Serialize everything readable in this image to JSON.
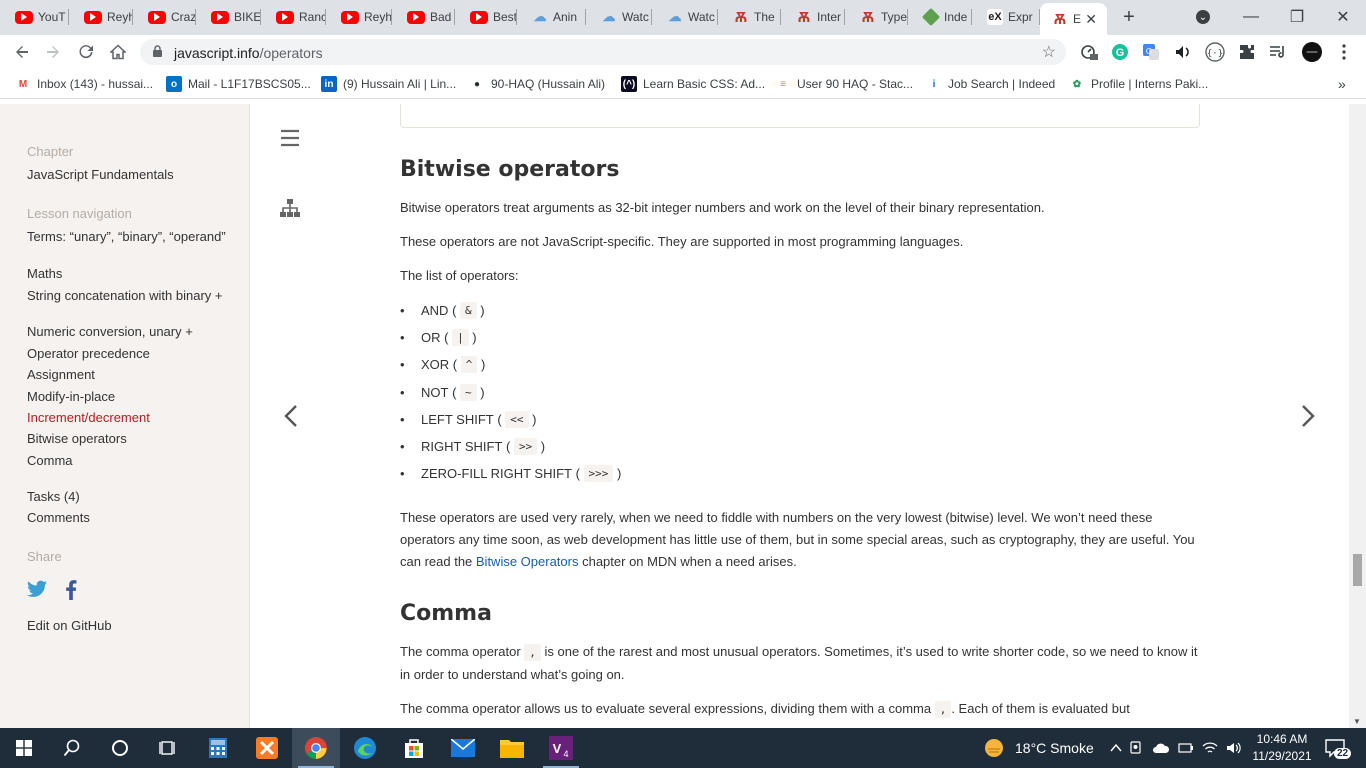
{
  "browser": {
    "tabs": [
      {
        "title": "YouT",
        "icon": "youtube-icon"
      },
      {
        "title": "Reyh",
        "icon": "youtube-icon"
      },
      {
        "title": "Craz",
        "icon": "youtube-icon"
      },
      {
        "title": "BIKE",
        "icon": "youtube-icon"
      },
      {
        "title": "Ranc",
        "icon": "youtube-icon"
      },
      {
        "title": "Reyh",
        "icon": "youtube-icon"
      },
      {
        "title": "Bad",
        "icon": "youtube-icon"
      },
      {
        "title": "Best",
        "icon": "youtube-icon"
      },
      {
        "title": "Anin",
        "icon": "cloud-icon"
      },
      {
        "title": "Watc",
        "icon": "cloud-icon"
      },
      {
        "title": "Watc",
        "icon": "cloud-icon"
      },
      {
        "title": "The",
        "icon": "javascript-info-icon"
      },
      {
        "title": "Inter",
        "icon": "javascript-info-icon"
      },
      {
        "title": "Type",
        "icon": "javascript-info-icon"
      },
      {
        "title": "Inde",
        "icon": "nodejs-icon"
      },
      {
        "title": "Expr",
        "icon": "ex-icon"
      },
      {
        "title": "E",
        "icon": "javascript-info-icon",
        "active": true
      }
    ],
    "new_tab_label": "+",
    "url_host": "javascript.info",
    "url_path": "/operators",
    "bookmarks": [
      {
        "label": "Inbox (143) - hussai...",
        "icon": "gmail-icon"
      },
      {
        "label": "Mail - L1F17BSCS05...",
        "icon": "outlook-icon"
      },
      {
        "label": "(9) Hussain Ali | Lin...",
        "icon": "linkedin-icon"
      },
      {
        "label": "90-HAQ (Hussain Ali)",
        "icon": "github-icon"
      },
      {
        "label": "Learn Basic CSS: Ad...",
        "icon": "freecodecamp-icon"
      },
      {
        "label": "User 90 HAQ - Stac...",
        "icon": "stackoverflow-icon"
      },
      {
        "label": "Job Search | Indeed",
        "icon": "indeed-icon"
      },
      {
        "label": "Profile | Interns Paki...",
        "icon": "interns-icon"
      }
    ],
    "bookmarks_overflow": "»"
  },
  "sidebar": {
    "chapter_label": "Chapter",
    "chapter_title": "JavaScript Fundamentals",
    "lesson_nav_label": "Lesson navigation",
    "lessons": [
      "Terms: “unary”, “binary”, “operand”",
      "Maths",
      "String concatenation with binary +",
      "Numeric conversion, unary +",
      "Operator precedence",
      "Assignment",
      "Modify-in-place",
      "Increment/decrement",
      "Bitwise operators",
      "Comma"
    ],
    "current_lesson_index": 7,
    "tasks": "Tasks (4)",
    "comments": "Comments",
    "share_label": "Share",
    "edit_github": "Edit on GitHub"
  },
  "article": {
    "bitwise_heading": "Bitwise operators",
    "p1": "Bitwise operators treat arguments as 32-bit integer numbers and work on the level of their binary representation.",
    "p2": "These operators are not JavaScript-specific. They are supported in most programming languages.",
    "p3": "The list of operators:",
    "operators": [
      {
        "name": "AND",
        "symbol": "&"
      },
      {
        "name": "OR",
        "symbol": "|"
      },
      {
        "name": "XOR",
        "symbol": "^"
      },
      {
        "name": "NOT",
        "symbol": "~"
      },
      {
        "name": "LEFT SHIFT",
        "symbol": "<<"
      },
      {
        "name": "RIGHT SHIFT",
        "symbol": ">>"
      },
      {
        "name": "ZERO-FILL RIGHT SHIFT",
        "symbol": ">>>"
      }
    ],
    "p4_before": "These operators are used very rarely, when we need to fiddle with numbers on the very lowest (bitwise) level. We won’t need these operators any time soon, as web development has little use of them, but in some special areas, such as cryptography, they are useful. You can read the ",
    "p4_link": "Bitwise Operators",
    "p4_after": " chapter on MDN when a need arises.",
    "comma_heading": "Comma",
    "p5_before": "The comma operator ",
    "p5_code": ",",
    "p5_after": " is one of the rarest and most unusual operators. Sometimes, it’s used to write shorter code, so we need to know it in order to understand what’s going on.",
    "p6_before": "The comma operator allows us to evaluate several expressions, dividing them with a comma ",
    "p6_code": ",",
    "p6_after": ". Each of them is evaluated but"
  },
  "taskbar": {
    "weather": "18°C  Smoke",
    "time": "10:46 AM",
    "date": "11/29/2021",
    "notifications": "22",
    "apps": [
      "start-icon",
      "search-icon",
      "cortana-icon",
      "task-view-icon",
      "calculator-icon",
      "xampp-icon",
      "chrome-icon",
      "edge-icon",
      "store-icon",
      "mail-icon",
      "file-explorer-icon",
      "visual-studio-icon"
    ]
  },
  "colors": {
    "sidebar_bg": "#f5f2f0",
    "current_lesson": "#b21f1f",
    "link": "#1a5da8",
    "taskbar_bg": "#1f2d3a"
  }
}
